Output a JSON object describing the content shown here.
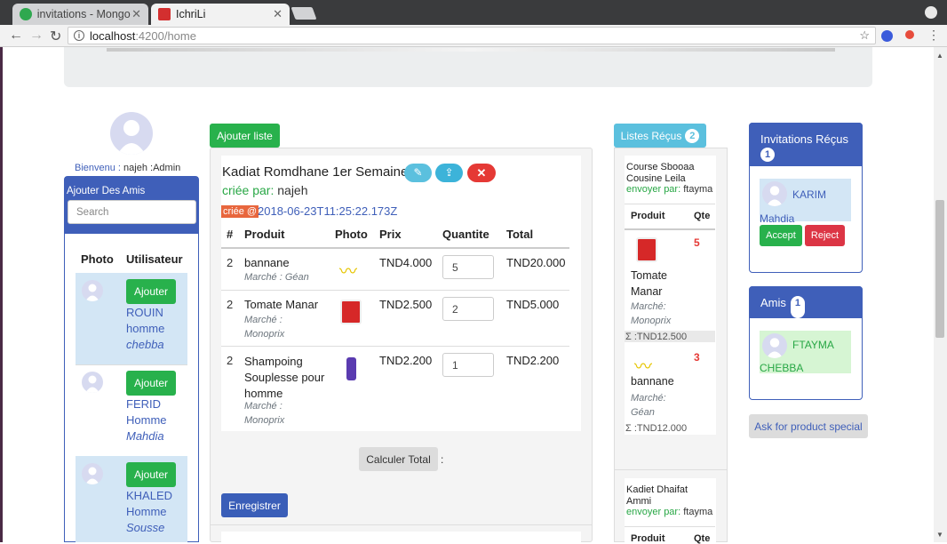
{
  "browser": {
    "tabs": [
      {
        "title": "invitations - Mongo",
        "icon": "leaf-icon"
      },
      {
        "title": "IchriLi",
        "icon": "angular-icon"
      }
    ],
    "url_host": "localhost",
    "url_path": ":4200/home"
  },
  "welcome": {
    "prefix": "Bienvenu :",
    "user": "najeh :Admin"
  },
  "friends_panel": {
    "title": "Ajouter Des Amis",
    "search_placeholder": "Search",
    "col_photo": "Photo",
    "col_user": "Utilisateur",
    "add_label": "Ajouter",
    "users": [
      {
        "name": "ROUIN",
        "gender": "homme",
        "city": "chebba"
      },
      {
        "name": "FERID",
        "gender": "Homme",
        "city": "Mahdia"
      },
      {
        "name": "KHALED",
        "gender": "Homme",
        "city": "Sousse"
      }
    ]
  },
  "list": {
    "add_list_label": "Ajouter liste",
    "title": "Kadiat Romdhane 1er Semaine",
    "created_by_label": "criée par:",
    "created_by": "najeh",
    "created_at_label": "criée @",
    "created_at": "2018-06-23T11:25:22.173Z",
    "headers": [
      "#",
      "Produit",
      "Photo",
      "Prix",
      "Quantite",
      "Total"
    ],
    "rows": [
      {
        "num": "2",
        "product": "bannane",
        "market": "Marché : Géan",
        "price": "TND4.000",
        "qty": "5",
        "total": "TND20.000",
        "icon": "banana-icon"
      },
      {
        "num": "2",
        "product": "Tomate Manar",
        "market": "Marché : Monoprix",
        "price": "TND2.500",
        "qty": "2",
        "total": "TND5.000",
        "icon": "tomato-can-icon"
      },
      {
        "num": "2",
        "product": "Shampoing Souplesse pour homme",
        "market": "Marché : Monoprix",
        "price": "TND2.200",
        "qty": "1",
        "total": "TND2.200",
        "icon": "shampoo-icon"
      }
    ],
    "calc_label": "Calculer Total",
    "calc_result": ":",
    "save_label": "Enregistrer"
  },
  "received": {
    "button_label": "Listes Réçus",
    "count": "2",
    "lists": [
      {
        "name": "Course Sbooaa Cousine Leila",
        "sent_label": "envoyer par:",
        "sender": "ftayma",
        "col_product": "Produit",
        "col_qty": "Qte",
        "items": [
          {
            "name": "Tomate Manar",
            "market": "Marché: Monoprix",
            "qty": "5",
            "subtotal": "Σ :TND12.500",
            "icon": "tomato-can-icon"
          },
          {
            "name": "bannane",
            "market": "Marché: Géan",
            "qty": "3",
            "subtotal": "Σ :TND12.000",
            "icon": "banana-icon"
          }
        ]
      },
      {
        "name": "Kadiet Dhaifat Ammi",
        "sent_label": "envoyer par:",
        "sender": "ftayma",
        "col_product": "Produit",
        "col_qty": "Qte"
      }
    ]
  },
  "invitations": {
    "title": "Invitations Réçus",
    "count": "1",
    "items": [
      {
        "name": "KARIM",
        "city": "Mahdia",
        "accept": "Accept",
        "reject": "Reject"
      }
    ]
  },
  "amis": {
    "title": "Amis",
    "count": "1",
    "items": [
      {
        "name": "FTAYMA",
        "city": "CHEBBA"
      }
    ]
  },
  "special": {
    "label": "Ask for product special"
  }
}
